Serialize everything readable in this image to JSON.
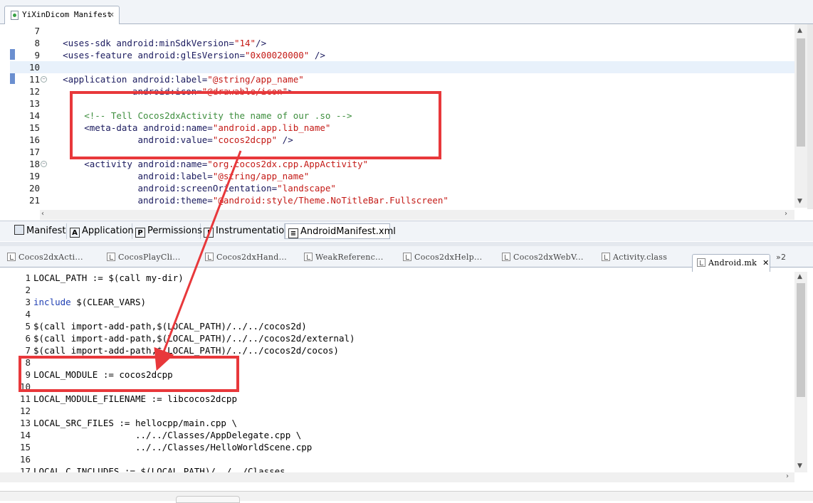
{
  "top_editor": {
    "tab_title": "YiXinDicom Manifest",
    "close_glyph": "✕",
    "lines": [
      {
        "num": "7",
        "parts": []
      },
      {
        "num": "8",
        "parts": [
          [
            "tag",
            "    <uses-sdk android:minSdkVersion="
          ],
          [
            "str",
            "\"14\""
          ],
          [
            "tag",
            "/>"
          ]
        ]
      },
      {
        "num": "9",
        "parts": [
          [
            "tag",
            "    <uses-feature android:glEsVersion="
          ],
          [
            "str",
            "\"0x00020000\""
          ],
          [
            "tag",
            " />"
          ]
        ]
      },
      {
        "num": "10",
        "parts": []
      },
      {
        "num": "11",
        "parts": [
          [
            "tag",
            "    <application android:label="
          ],
          [
            "str",
            "\"@string/app_name\""
          ]
        ]
      },
      {
        "num": "12",
        "parts": [
          [
            "tag",
            "                 android:icon="
          ],
          [
            "str",
            "\"@drawable/icon\""
          ],
          [
            "tag",
            ">"
          ]
        ]
      },
      {
        "num": "13",
        "parts": []
      },
      {
        "num": "14",
        "parts": [
          [
            "com",
            "        <!-- Tell Cocos2dxActivity the name of our .so -->"
          ]
        ]
      },
      {
        "num": "15",
        "parts": [
          [
            "tag",
            "        <meta-data android:name="
          ],
          [
            "str",
            "\"android.app.lib_name\""
          ]
        ]
      },
      {
        "num": "16",
        "parts": [
          [
            "tag",
            "                  android:value="
          ],
          [
            "str",
            "\"cocos2dcpp\""
          ],
          [
            "tag",
            " />"
          ]
        ]
      },
      {
        "num": "17",
        "parts": []
      },
      {
        "num": "18",
        "parts": [
          [
            "tag",
            "        <activity android:name="
          ],
          [
            "str",
            "\"org.cocos2dx.cpp.AppActivity\""
          ]
        ]
      },
      {
        "num": "19",
        "parts": [
          [
            "tag",
            "                  android:label="
          ],
          [
            "str",
            "\"@string/app_name\""
          ]
        ]
      },
      {
        "num": "20",
        "parts": [
          [
            "tag",
            "                  android:screenOrientation="
          ],
          [
            "str",
            "\"landscape\""
          ]
        ]
      },
      {
        "num": "21",
        "parts": [
          [
            "tag",
            "                  android:theme="
          ],
          [
            "str",
            "\"@android:style/Theme.NoTitleBar.Fullscreen\""
          ]
        ]
      }
    ],
    "page_tabs": [
      {
        "label": "Manifest",
        "icon": "",
        "icon_name": "manifest-page-icon"
      },
      {
        "label": "Application",
        "icon": "A",
        "icon_name": "application-page-icon"
      },
      {
        "label": "Permissions",
        "icon": "P",
        "icon_name": "permissions-page-icon"
      },
      {
        "label": "Instrumentation",
        "icon": "I",
        "icon_name": "instrumentation-page-icon"
      },
      {
        "label": "AndroidManifest.xml",
        "icon": "≡",
        "icon_name": "xml-source-page-icon"
      }
    ]
  },
  "bottom_editor": {
    "tabs": [
      {
        "label": "Cocos2dxActi..."
      },
      {
        "label": "CocosPlayCli..."
      },
      {
        "label": "Cocos2dxHand..."
      },
      {
        "label": "WeakReferenc..."
      },
      {
        "label": "Cocos2dxHelp..."
      },
      {
        "label": "Cocos2dxWebV..."
      },
      {
        "label": "Activity.class"
      }
    ],
    "active_tab": "Android.mk",
    "close_glyph": "✕",
    "overflow_label": "»2",
    "lines": [
      {
        "num": "1",
        "parts": [
          [
            "txt",
            "LOCAL_PATH := $(call my-dir)"
          ]
        ]
      },
      {
        "num": "2",
        "parts": []
      },
      {
        "num": "3",
        "parts": [
          [
            "kw",
            "include"
          ],
          [
            "txt",
            " $(CLEAR_VARS)"
          ]
        ]
      },
      {
        "num": "4",
        "parts": []
      },
      {
        "num": "5",
        "parts": [
          [
            "txt",
            "$(call import-add-path,$(LOCAL_PATH)/../../cocos2d)"
          ]
        ]
      },
      {
        "num": "6",
        "parts": [
          [
            "txt",
            "$(call import-add-path,$(LOCAL_PATH)/../../cocos2d/external)"
          ]
        ]
      },
      {
        "num": "7",
        "parts": [
          [
            "txt",
            "$(call import-add-path,$(LOCAL_PATH)/../../cocos2d/cocos)"
          ]
        ]
      },
      {
        "num": "8",
        "parts": []
      },
      {
        "num": "9",
        "parts": [
          [
            "txt",
            "LOCAL_MODULE := cocos2dcpp"
          ]
        ]
      },
      {
        "num": "10",
        "parts": []
      },
      {
        "num": "11",
        "parts": [
          [
            "txt",
            "LOCAL_MODULE_FILENAME := libcocos2dcpp"
          ]
        ]
      },
      {
        "num": "12",
        "parts": []
      },
      {
        "num": "13",
        "parts": [
          [
            "txt",
            "LOCAL_SRC_FILES := hellocpp/main.cpp \\"
          ]
        ]
      },
      {
        "num": "14",
        "parts": [
          [
            "txt",
            "                   ../../Classes/AppDelegate.cpp \\"
          ]
        ]
      },
      {
        "num": "15",
        "parts": [
          [
            "txt",
            "                   ../../Classes/HelloWorldScene.cpp"
          ]
        ]
      },
      {
        "num": "16",
        "parts": []
      },
      {
        "num": "17",
        "parts": [
          [
            "txt",
            "LOCAL_C_INCLUDES := $(LOCAL_PATH)/../../Classes"
          ]
        ]
      }
    ]
  },
  "colors": {
    "annotation": "#e8383b",
    "tag": "#1a1a5e",
    "string": "#c41a16",
    "comment": "#3f8f3f",
    "keyword": "#1f3fb3"
  }
}
